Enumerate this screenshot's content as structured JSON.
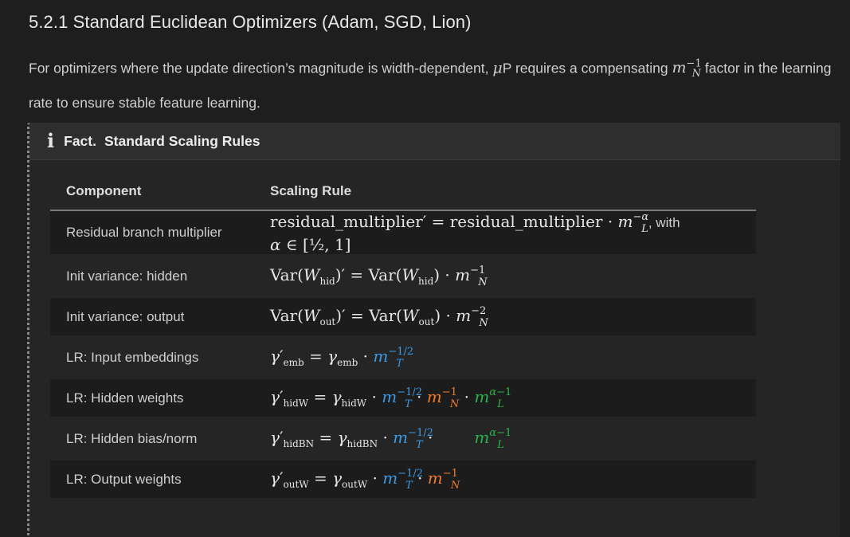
{
  "section": {
    "title": "5.2.1 Standard Euclidean Optimizers (Adam, SGD, Lion)"
  },
  "intro": {
    "before": "For optimizers where the update direction’s magnitude is width-dependent, ",
    "mu": "μ",
    "mu_suffix": "P requires a compensating ",
    "factor_base": "m",
    "factor_sup": "−1",
    "factor_sub": "N",
    "after": " factor in the learning rate to ensure stable feature learning."
  },
  "fact": {
    "icon": "i",
    "label": "Fact.",
    "title": "Standard Scaling Rules",
    "table": {
      "headers": [
        "Component",
        "Scaling Rule"
      ],
      "rows": [
        {
          "component": "Residual branch multiplier",
          "with_text": ", with"
        },
        {
          "component": "Init variance: hidden"
        },
        {
          "component": "Init variance: output"
        },
        {
          "component": "LR: Input embeddings"
        },
        {
          "component": "LR: Hidden weights"
        },
        {
          "component": "LR: Hidden bias/norm"
        },
        {
          "component": "LR: Output weights"
        }
      ]
    }
  },
  "colors": {
    "width_T": "#3b9ae6",
    "width_N": "#f07b2d",
    "depth_L": "#29b34a"
  }
}
